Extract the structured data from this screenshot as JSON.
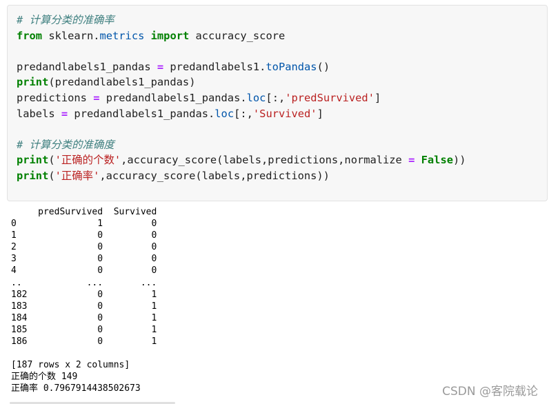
{
  "code_cell": {
    "line1_comment": "# 计算分类的准确率",
    "line2": {
      "kw_from": "from",
      "module_a": " sklearn.",
      "module_b": "metrics",
      "kw_import": "import",
      "name": " accuracy_score"
    },
    "line4": {
      "lhs": "predandlabels1_pandas ",
      "eq": "=",
      "rhs_a": " predandlabels1.",
      "rhs_b": "toPandas",
      "rhs_c": "()"
    },
    "line5": {
      "fn": "print",
      "rest": "(predandlabels1_pandas)"
    },
    "line6": {
      "lhs": "predictions ",
      "eq": "=",
      "mid": " predandlabels1_pandas.",
      "attr": "loc",
      "open": "[:,",
      "str": "'predSurvived'",
      "close": "]"
    },
    "line7": {
      "lhs": "labels ",
      "eq": "=",
      "mid": " predandlabels1_pandas.",
      "attr": "loc",
      "open": "[:,",
      "str": "'Survived'",
      "close": "]"
    },
    "line9_comment": "# 计算分类的准确度",
    "line10": {
      "fn": "print",
      "open": "(",
      "str": "'正确的个数'",
      "mid": ",accuracy_score(labels,predictions,normalize ",
      "eq": "=",
      "kw": " False",
      "close": "))"
    },
    "line11": {
      "fn": "print",
      "open": "(",
      "str": "'正确率'",
      "mid": ",accuracy_score(labels,predictions))"
    }
  },
  "output": {
    "lines": [
      "     predSurvived  Survived",
      "0               1         0",
      "1               0         0",
      "2               0         0",
      "3               0         0",
      "4               0         0",
      "..            ...       ...",
      "182             0         1",
      "183             0         1",
      "184             0         1",
      "185             0         1",
      "186             0         1",
      "",
      "[187 rows x 2 columns]",
      "正确的个数 149",
      "正确率 0.7967914438502673"
    ]
  },
  "watermark": "CSDN @客院载论"
}
